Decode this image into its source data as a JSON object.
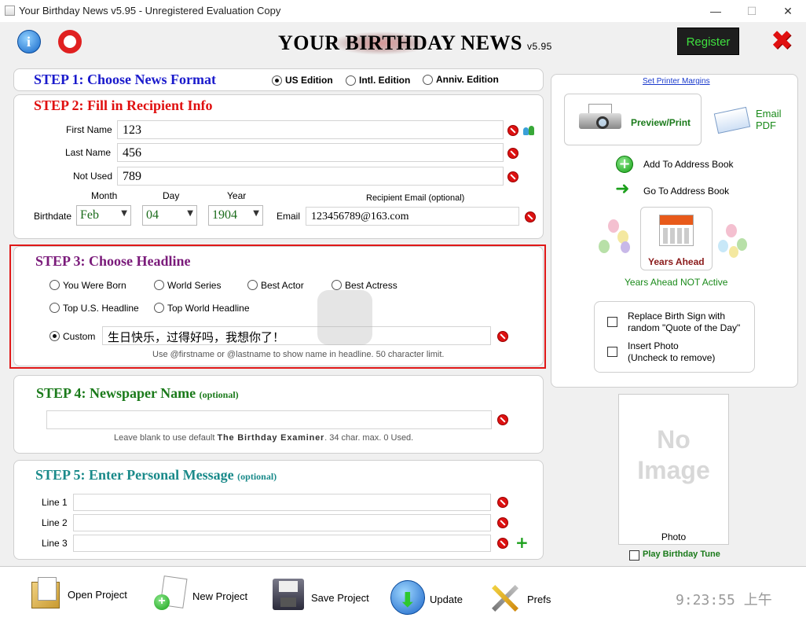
{
  "window": {
    "title": "Your Birthday News v5.95 - Unregistered Evaluation Copy",
    "minimize": "—",
    "maximize": "☐",
    "close": "✕"
  },
  "header": {
    "app_title": "YOUR BIRTHDAY NEWS",
    "version": "v5.95",
    "register": "Register"
  },
  "step1": {
    "title": "STEP 1: Choose News Format",
    "options": [
      "US Edition",
      "Intl. Edition",
      "Anniv. Edition"
    ]
  },
  "step2": {
    "title": "STEP 2: Fill in Recipient Info",
    "first_name_label": "First Name",
    "first_name": "123",
    "last_name_label": "Last Name",
    "last_name": "456",
    "not_used_label": "Not Used",
    "not_used": "789",
    "month_label": "Month",
    "day_label": "Day",
    "year_label": "Year",
    "birthdate_label": "Birthdate",
    "month": "Feb",
    "day": "04",
    "year": "1904",
    "email_caption": "Recipient Email (optional)",
    "email_label": "Email",
    "email": "123456789@163.com"
  },
  "step3": {
    "title": "STEP 3: Choose Headline",
    "options": [
      "You Were Born",
      "World Series",
      "Best Actor",
      "Best Actress",
      "Top U.S. Headline",
      "Top World Headline"
    ],
    "custom_label": "Custom",
    "custom_value": "生日快乐，过得好吗，我想你了！",
    "hint": "Use @firstname or @lastname to show name in headline. 50 character limit."
  },
  "step4": {
    "title": "STEP 4: Newspaper Name",
    "optional": "(optional)",
    "value": "",
    "hint_pre": "Leave blank to use default",
    "hint_name": "The Birthday Examiner",
    "hint_post": ". 34 char. max. 0 Used."
  },
  "step5": {
    "title": "STEP 5: Enter Personal Message",
    "optional": "(optional)",
    "line_labels": [
      "Line 1",
      "Line 2",
      "Line 3"
    ]
  },
  "right": {
    "printer_margins": "Set Printer Margins",
    "preview_print": "Preview/Print",
    "email_pdf_1": "Email",
    "email_pdf_2": "PDF",
    "add_address": "Add To Address Book",
    "go_address": "Go To Address Book",
    "years_ahead": "Years Ahead",
    "years_ahead_status": "Years Ahead NOT Active",
    "replace_sign_1": "Replace Birth Sign with",
    "replace_sign_2": "random \"Quote of the Day\"",
    "insert_photo_1": "Insert Photo",
    "insert_photo_2": "(Uncheck to remove)",
    "no_image_1": "No",
    "no_image_2": "Image",
    "photo_label": "Photo",
    "play_tune": "Play Birthday Tune"
  },
  "toolbar": {
    "open": "Open Project",
    "new": "New Project",
    "save": "Save Project",
    "update": "Update",
    "prefs": "Prefs",
    "clock": "9:23:55 上午"
  },
  "colors": {
    "step1": "#1a1acc",
    "step2": "#e01010",
    "step3": "#7a1a7a",
    "step4": "#1a7a1a",
    "step5": "#1a8a8a"
  }
}
